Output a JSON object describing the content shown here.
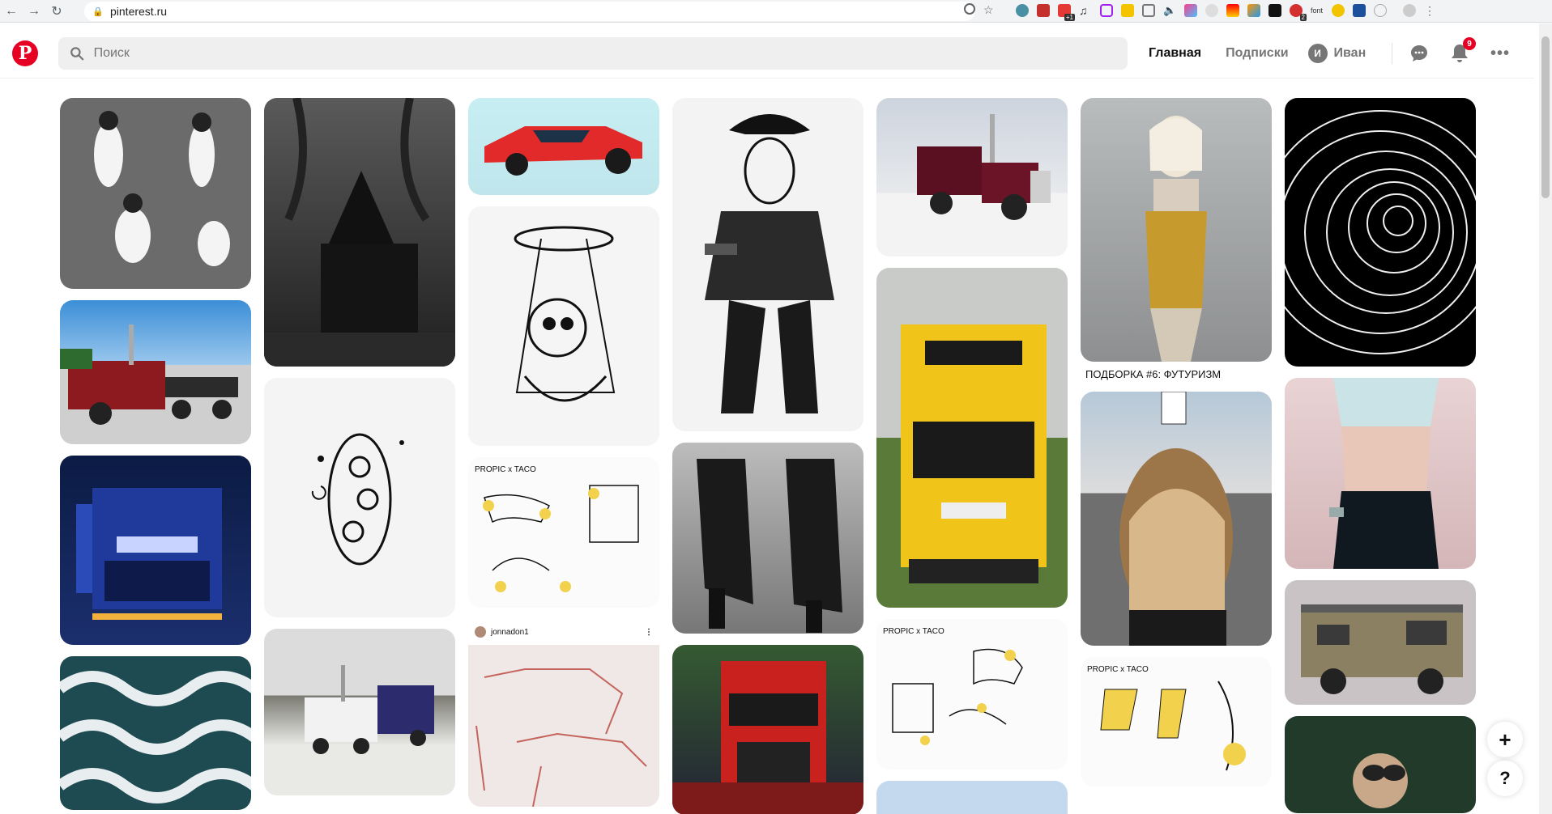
{
  "browser": {
    "url": "pinterest.ru",
    "extension_badges": {
      "ext4": "+1",
      "ext14": "2",
      "font": "font"
    }
  },
  "header": {
    "logo": "P",
    "search_placeholder": "Поиск",
    "nav": {
      "home": "Главная",
      "following": "Подписки"
    },
    "user": {
      "initial": "И",
      "name": "Иван"
    },
    "notifications_count": "9"
  },
  "pins": {
    "col6_caption": "ПОДБОРКА #6: ФУТУРИЗМ",
    "col3_user": "jonnadon1"
  },
  "fab": {
    "add": "+",
    "help": "?"
  },
  "colors": {
    "brand": "#e60023",
    "search_bg": "#efefef"
  }
}
